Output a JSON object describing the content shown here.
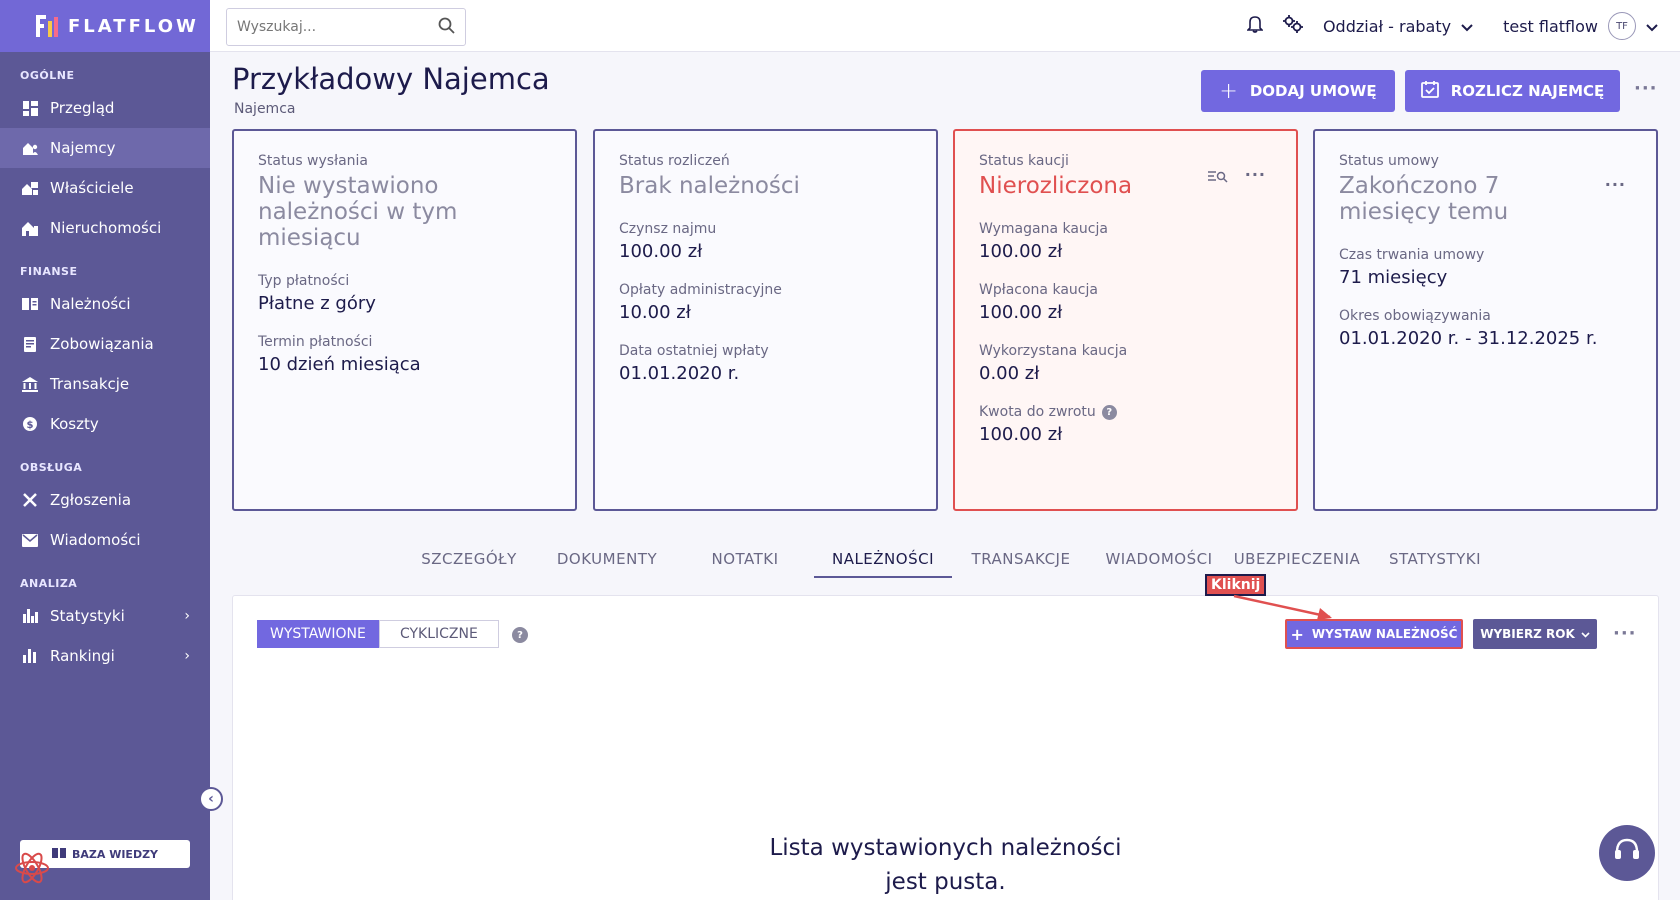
{
  "brand": {
    "logo_text": "FLATFLOW"
  },
  "sidebar": {
    "sections": [
      {
        "title": "OGÓLNE",
        "items": [
          {
            "label": "Przegląd",
            "icon": "dashboard-icon"
          },
          {
            "label": "Najemcy",
            "icon": "tenant-icon",
            "active": true
          },
          {
            "label": "Właściciele",
            "icon": "owner-icon"
          },
          {
            "label": "Nieruchomości",
            "icon": "building-icon"
          }
        ]
      },
      {
        "title": "FINANSE",
        "items": [
          {
            "label": "Należności",
            "icon": "receivables-icon"
          },
          {
            "label": "Zobowiązania",
            "icon": "liabilities-icon"
          },
          {
            "label": "Transakcje",
            "icon": "bank-icon"
          },
          {
            "label": "Koszty",
            "icon": "costs-icon"
          }
        ]
      },
      {
        "title": "OBSŁUGA",
        "items": [
          {
            "label": "Zgłoszenia",
            "icon": "tools-icon"
          },
          {
            "label": "Wiadomości",
            "icon": "mail-icon"
          }
        ]
      },
      {
        "title": "ANALIZA",
        "items": [
          {
            "label": "Statystyki",
            "icon": "bar-chart-icon",
            "expandable": true
          },
          {
            "label": "Rankingi",
            "icon": "ranking-icon",
            "expandable": true
          }
        ]
      }
    ],
    "knowledge_base_label": "BAZA WIEDZY"
  },
  "topbar": {
    "search_placeholder": "Wyszukaj...",
    "branch_label": "Oddział - rabaty",
    "user_name": "test flatflow",
    "avatar_initials": "TF"
  },
  "header": {
    "title": "Przykładowy Najemca",
    "subtitle": "Najemca",
    "add_contract_label": "DODAJ UMOWĘ",
    "settle_tenant_label": "ROZLICZ NAJEMCĘ"
  },
  "cards": {
    "shipping": {
      "title": "Status wysłania",
      "status_lines": [
        "Nie wystawiono",
        "należności w tym",
        "miesiącu"
      ],
      "fields": [
        {
          "label": "Typ płatności",
          "value": "Płatne z góry"
        },
        {
          "label": "Termin płatności",
          "value": "10 dzień miesiąca"
        }
      ]
    },
    "settlement": {
      "title": "Status rozliczeń",
      "status": "Brak należności",
      "fields": [
        {
          "label": "Czynsz najmu",
          "value": "100.00 zł"
        },
        {
          "label": "Opłaty administracyjne",
          "value": "10.00 zł"
        },
        {
          "label": "Data ostatniej wpłaty",
          "value": "01.01.2020 r."
        }
      ]
    },
    "deposit": {
      "title": "Status kaucji",
      "status": "Nierozliczona",
      "fields": [
        {
          "label": "Wymagana kaucja",
          "value": "100.00 zł"
        },
        {
          "label": "Wpłacona kaucja",
          "value": "100.00 zł"
        },
        {
          "label": "Wykorzystana kaucja",
          "value": "0.00 zł"
        },
        {
          "label": "Kwota do zwrotu",
          "value": "100.00 zł"
        }
      ]
    },
    "contract": {
      "title": "Status umowy",
      "status_lines": [
        "Zakończono 7",
        "miesięcy temu"
      ],
      "fields": [
        {
          "label": "Czas trwania umowy",
          "value": "71 miesięcy"
        },
        {
          "label": "Okres obowiązywania",
          "value": "01.01.2020 r. - 31.12.2025 r."
        }
      ]
    }
  },
  "tabs": [
    "SZCZEGÓŁY",
    "DOKUMENTY",
    "NOTATKI",
    "NALEŻNOŚCI",
    "TRANSAKCJE",
    "WIADOMOŚCI",
    "UBEZPIECZENIA",
    "STATYSTYKI"
  ],
  "active_tab": "NALEŻNOŚCI",
  "panel": {
    "toggle_issued": "WYSTAWIONE",
    "toggle_cyclic": "CYKLICZNE",
    "issue_button": "WYSTAW NALEŻNOŚĆ",
    "year_button": "WYBIERZ ROK",
    "empty_line1": "Lista wystawionych należności",
    "empty_line2": "jest pusta."
  },
  "annotation": {
    "label": "Kliknij"
  },
  "colors": {
    "primary": "#7268e0",
    "sidebar": "#5c5896",
    "danger": "#e05050",
    "text": "#1d1b4b"
  }
}
